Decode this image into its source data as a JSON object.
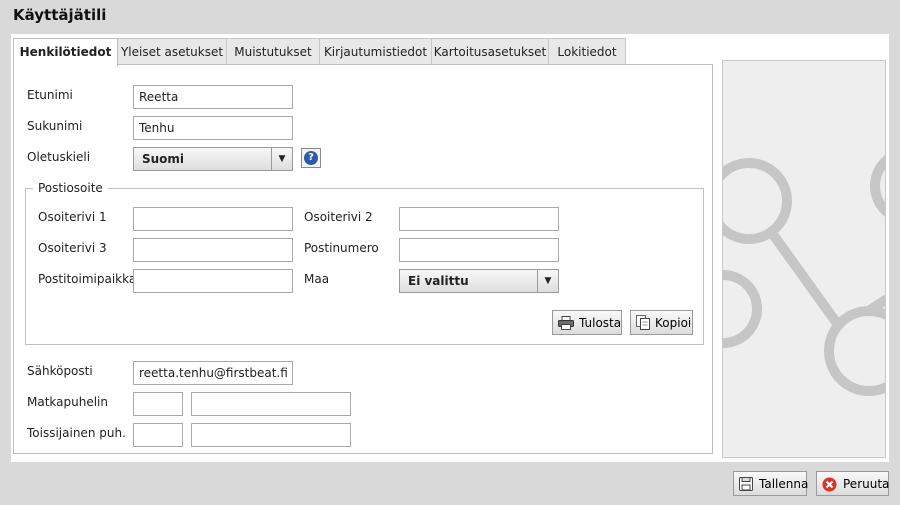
{
  "window": {
    "title": "Käyttäjätili"
  },
  "tabs": [
    {
      "label": "Henkilötiedot"
    },
    {
      "label": "Yleiset asetukset"
    },
    {
      "label": "Muistutukset"
    },
    {
      "label": "Kirjautumistiedot"
    },
    {
      "label": "Kartoitusasetukset"
    },
    {
      "label": "Lokitiedot"
    }
  ],
  "form": {
    "first_name_label": "Etunimi",
    "first_name_value": "Reetta",
    "last_name_label": "Sukunimi",
    "last_name_value": "Tenhu",
    "language_label": "Oletuskieli",
    "language_value": "Suomi",
    "address": {
      "legend": "Postiosoite",
      "line1_label": "Osoiterivi 1",
      "line2_label": "Osoiterivi 2",
      "line3_label": "Osoiterivi 3",
      "postcode_label": "Postinumero",
      "city_label": "Postitoimipaikka",
      "country_label": "Maa",
      "country_value": "Ei valittu",
      "print_label": "Tulosta",
      "copy_label": "Kopioi"
    },
    "email_label": "Sähköposti",
    "email_value": "reetta.tenhu@firstbeat.fi",
    "mobile_label": "Matkapuhelin",
    "secondary_phone_label": "Toissijainen puh."
  },
  "footer": {
    "save_label": "Tallenna",
    "cancel_label": "Peruuta"
  },
  "colors": {
    "help_icon": "#2a5aa8",
    "cancel_icon": "#d9342b"
  }
}
